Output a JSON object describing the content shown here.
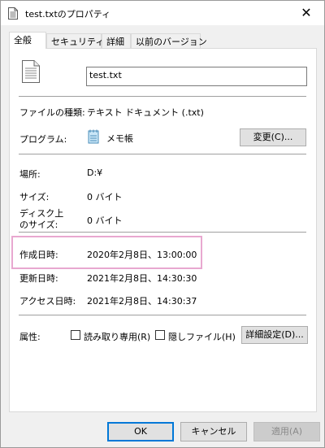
{
  "window": {
    "title": "test.txtのプロパティ",
    "close_glyph": "✕"
  },
  "tabs": [
    {
      "label": "全般",
      "active": true
    },
    {
      "label": "セキュリティ",
      "active": false
    },
    {
      "label": "詳細",
      "active": false
    },
    {
      "label": "以前のバージョン",
      "active": false
    }
  ],
  "file": {
    "name": "test.txt",
    "icon": "text-file-icon"
  },
  "type": {
    "label": "ファイルの種類:",
    "value": "テキスト ドキュメント (.txt)"
  },
  "program": {
    "label": "プログラム:",
    "value": "メモ帳",
    "icon": "notepad-icon",
    "change_button": "変更(C)..."
  },
  "location": {
    "label": "場所:",
    "value": "D:¥"
  },
  "size": {
    "label": "サイズ:",
    "value": "0 バイト"
  },
  "disk_size": {
    "label_line1": "ディスク上",
    "label_line2": "のサイズ:",
    "value": "0 バイト"
  },
  "created": {
    "label": "作成日時:",
    "value": "2020年2月8日、13:00:00"
  },
  "modified": {
    "label": "更新日時:",
    "value": "2021年2月8日、14:30:30"
  },
  "accessed": {
    "label": "アクセス日時:",
    "value": "2021年2月8日、14:30:37"
  },
  "attributes": {
    "label": "属性:",
    "readonly": {
      "label": "読み取り専用(R)",
      "checked": false
    },
    "hidden": {
      "label": "隠しファイル(H)",
      "checked": false
    },
    "advanced_button": "詳細設定(D)..."
  },
  "footer": {
    "ok": "OK",
    "cancel": "キャンセル",
    "apply": "適用(A)"
  },
  "colors": {
    "highlight_border": "#e8a8d0",
    "default_button_border": "#0078d7"
  }
}
